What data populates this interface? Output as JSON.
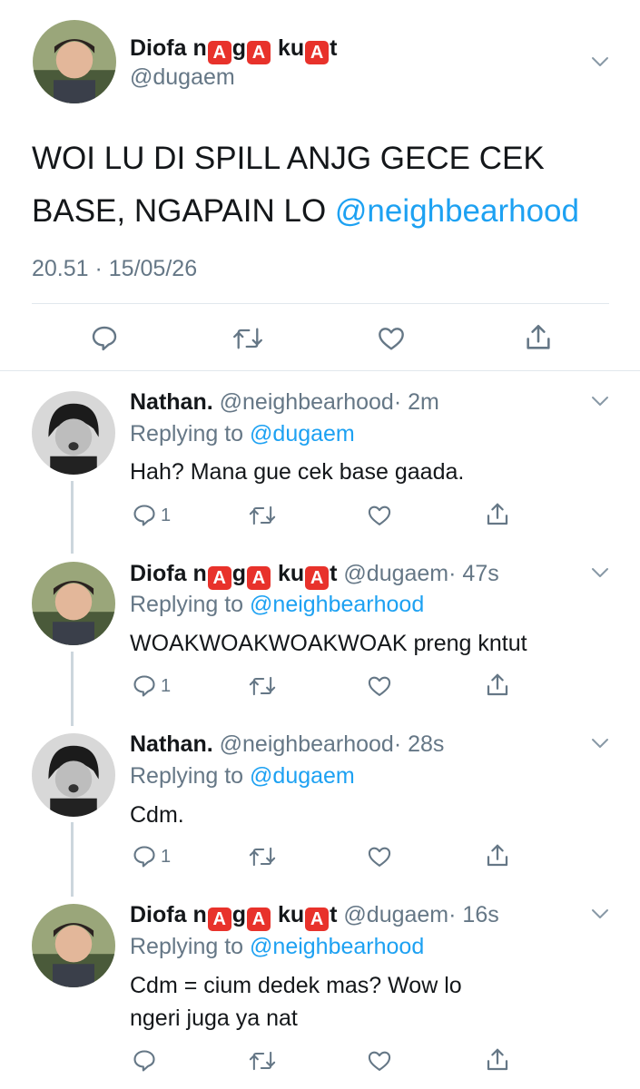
{
  "main_tweet": {
    "author": {
      "name_parts": [
        "Diofa n",
        "A",
        "g",
        "A",
        " ku",
        "A",
        "t"
      ],
      "handle": "@dugaem"
    },
    "text": "WOI LU DI SPILL ANJG GECE CEK BASE, NGAPAIN LO ",
    "mention": "@neighbearhood",
    "timestamp": "20.51 · 15/05/26",
    "actions": [
      "reply-icon",
      "retweet-icon",
      "like-icon",
      "share-icon"
    ]
  },
  "replies": [
    {
      "name": "Nathan.",
      "handle": "@neighbearhood",
      "time": "· 2m",
      "replying_label": "Replying to ",
      "replying_to": "@dugaem",
      "text": "Hah? Mana gue cek base gaada.",
      "reply_count": "1"
    },
    {
      "name_parts": [
        "Diofa n",
        "A",
        "g",
        "A",
        " ku",
        "A",
        "t"
      ],
      "handle": "@dugaem",
      "time": "· 47s",
      "replying_label": "Replying to ",
      "replying_to": "@neighbearhood",
      "text": "WOAKWOAKWOAKWOAK preng kntut",
      "reply_count": "1"
    },
    {
      "name": "Nathan.",
      "handle": "@neighbearhood",
      "time": "· 28s",
      "replying_label": "Replying to ",
      "replying_to": "@dugaem",
      "text": "Cdm.",
      "reply_count": "1"
    },
    {
      "name_parts": [
        "Diofa n",
        "A",
        "g",
        "A",
        " ku",
        "A",
        "t"
      ],
      "handle": "@dugaem",
      "time": "· 16s",
      "replying_label": "Replying to ",
      "replying_to": "@neighbearhood",
      "text": "Cdm = cium dedek mas? Wow lo ngeri juga ya nat",
      "reply_count": ""
    }
  ],
  "colors": {
    "link": "#1da1f2",
    "secondary": "#657786",
    "emoji_bg": "#e8322b",
    "divider": "#e1e8ed"
  }
}
